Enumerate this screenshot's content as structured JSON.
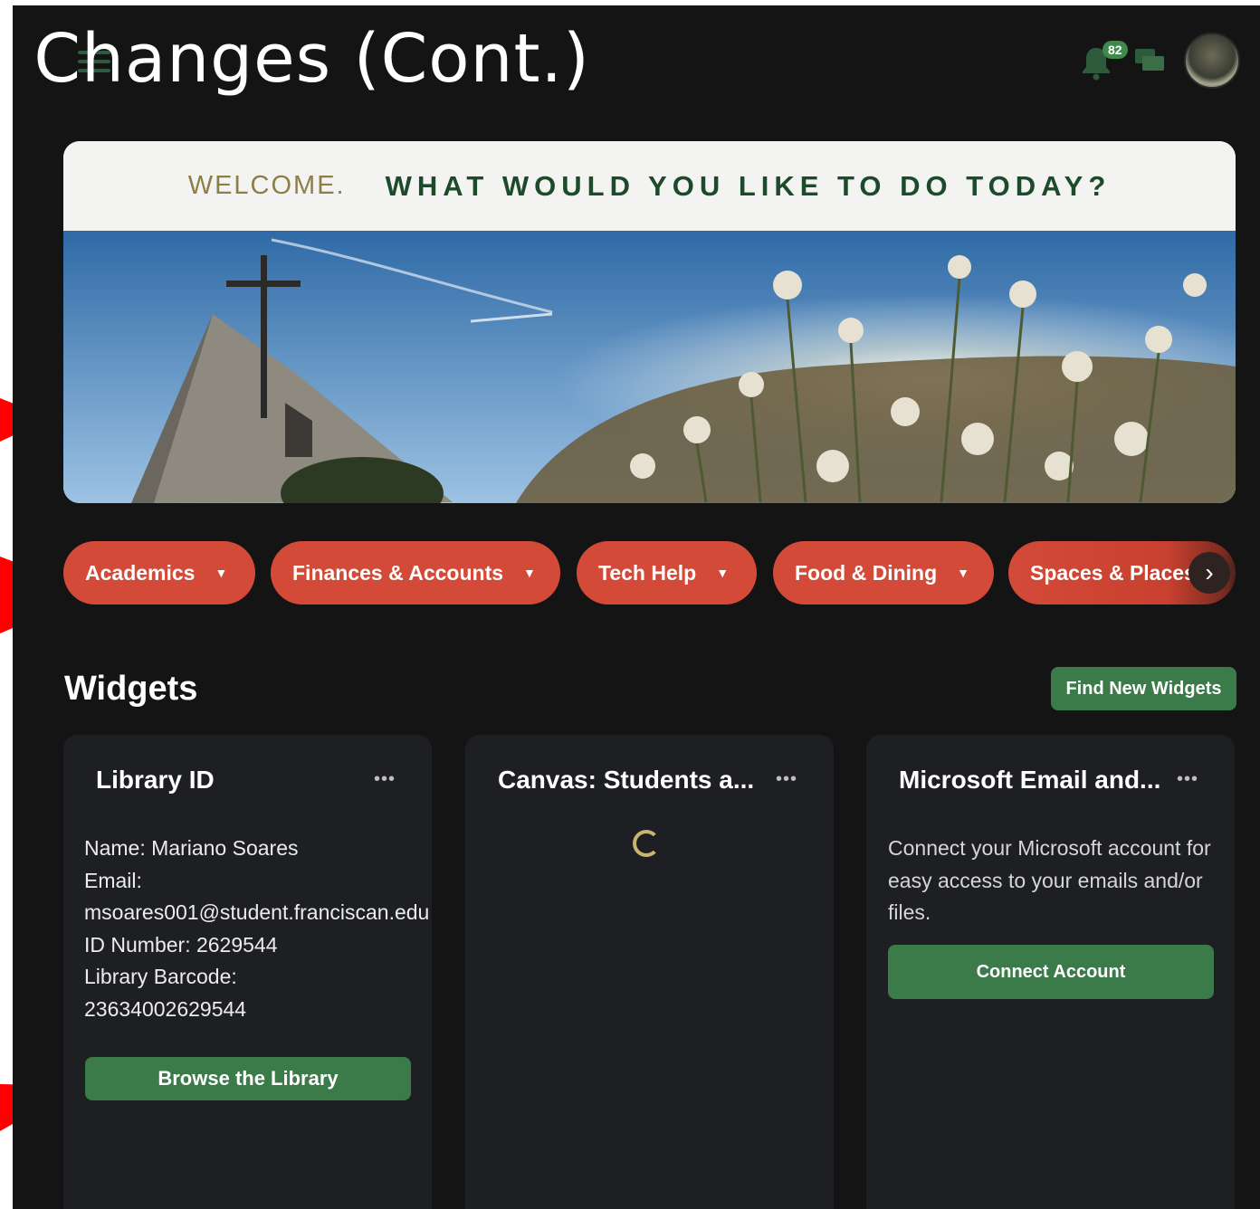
{
  "slide": {
    "title": "J Changes (Cont.)"
  },
  "header": {
    "notification_count": "82"
  },
  "banner": {
    "welcome": "WELCOME.",
    "prompt": "WHAT WOULD YOU LIKE TO DO TODAY?"
  },
  "nav_chips": [
    {
      "label": "Academics"
    },
    {
      "label": "Finances & Accounts"
    },
    {
      "label": "Tech Help"
    },
    {
      "label": "Food & Dining"
    },
    {
      "label": "Spaces & Places"
    }
  ],
  "widgets": {
    "title": "Widgets",
    "find_button": "Find New Widgets",
    "cards": [
      {
        "title": "Library ID",
        "lines": [
          "Name: Mariano Soares",
          "Email:",
          "msoares001@student.franciscan.edu",
          "ID Number: 2629544",
          "Library Barcode:",
          "23634002629544"
        ],
        "button": "Browse the Library"
      },
      {
        "title": "Canvas: Students a..."
      },
      {
        "title": "Microsoft Email and...",
        "text": "Connect your Microsoft account for easy access to your emails and/or files.",
        "button": "Connect Account"
      }
    ]
  },
  "colors": {
    "background": "#141414",
    "card": "#1e1f23",
    "chip_red": "#d44a38",
    "button_green": "#3b7b49",
    "annotation_arrow": "#ff0000"
  }
}
